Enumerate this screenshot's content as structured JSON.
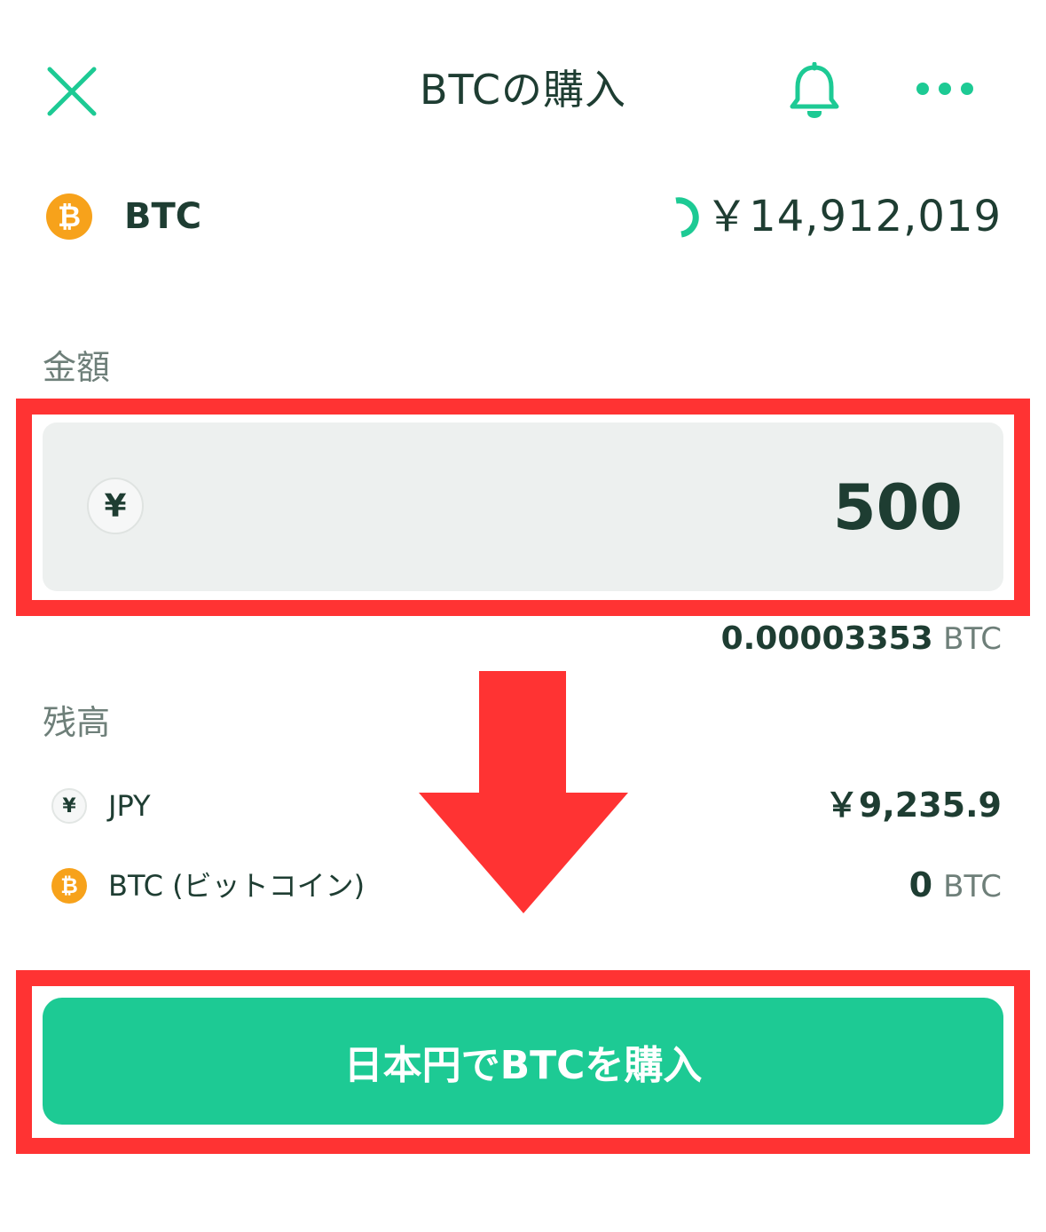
{
  "header": {
    "title": "BTCの購入",
    "close_icon": "close-icon",
    "bell_icon": "bell-icon",
    "more_icon": "more-horizontal-icon"
  },
  "ticker": {
    "icon_glyph": "₿",
    "symbol": "BTC",
    "price": "￥14,912,019"
  },
  "amount": {
    "label": "金額",
    "currency_glyph": "¥",
    "value": "500",
    "converted_value": "0.00003353",
    "converted_unit": "BTC"
  },
  "balance": {
    "label": "残高",
    "rows": [
      {
        "icon_glyph": "¥",
        "label": "JPY",
        "value": "￥9,235.9",
        "unit": ""
      },
      {
        "icon_glyph": "₿",
        "label": "BTC (ビットコイン)",
        "value": "0",
        "unit": "BTC"
      }
    ]
  },
  "buy_button": {
    "label": "日本円でBTCを購入"
  },
  "colors": {
    "accent_green": "#1dca94",
    "annotation_red": "#ff3333",
    "bitcoin_orange": "#f7a21b",
    "text_dark": "#1e3d32",
    "text_muted": "#6e7f79"
  }
}
